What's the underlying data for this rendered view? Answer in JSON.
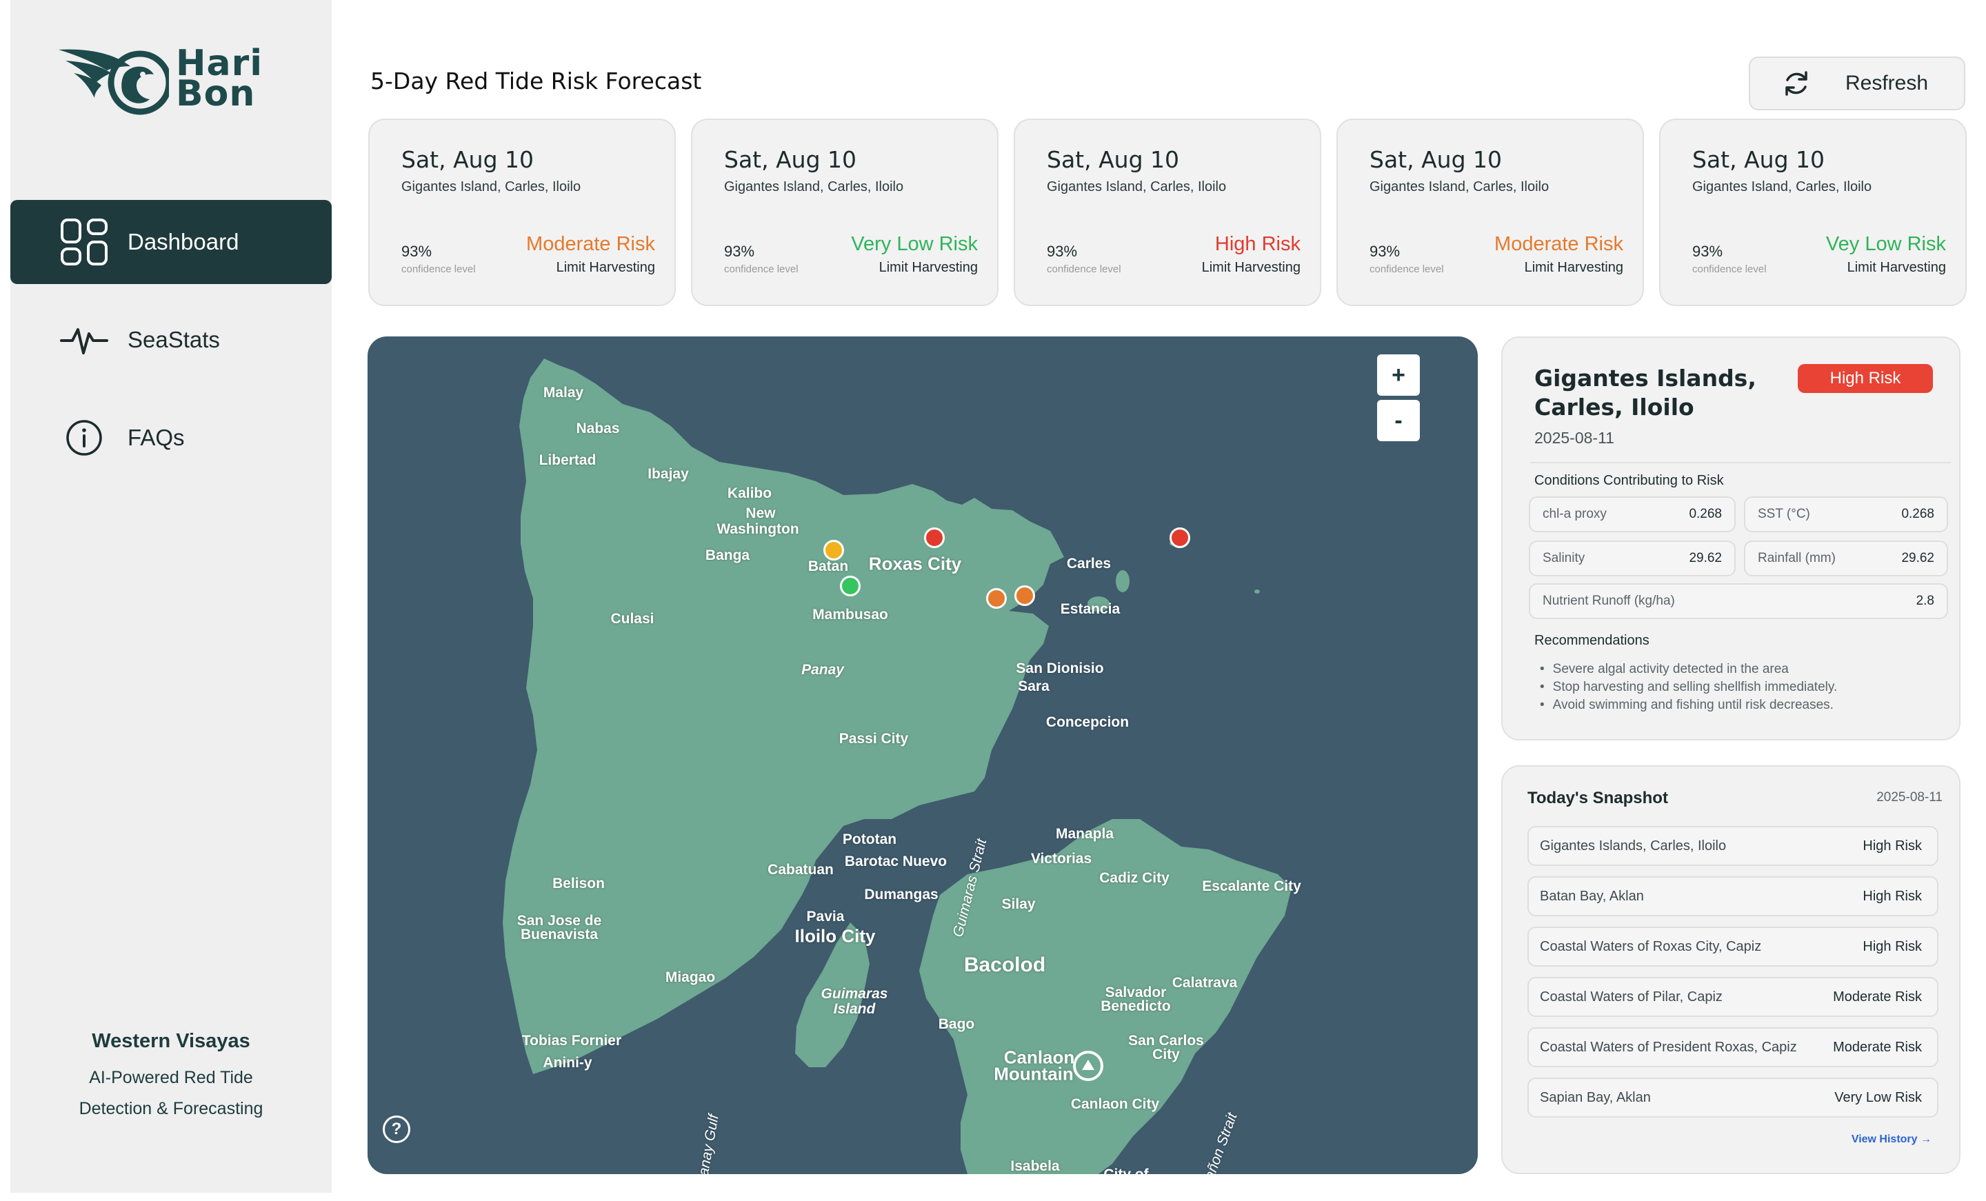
{
  "app": {
    "brand_line1": "Hari",
    "brand_line2": "Bon"
  },
  "nav": {
    "items": [
      {
        "label": "Dashboard",
        "icon": "grid-icon",
        "active": true
      },
      {
        "label": "SeaStats",
        "icon": "pulse-icon",
        "active": false
      },
      {
        "label": "FAQs",
        "icon": "info-icon",
        "active": false
      }
    ]
  },
  "footer": {
    "region": "Western Visayas",
    "tagline_line1": "AI-Powered Red Tide",
    "tagline_line2": "Detection & Forecasting"
  },
  "header": {
    "title": "5-Day Red Tide Risk Forecast",
    "refresh_label": "Resfresh"
  },
  "forecast": [
    {
      "date": "Sat, Aug 10",
      "location": "Gigantes Island, Carles, Iloilo",
      "confidence": "93%",
      "confidence_label": "confidence level",
      "risk": "Moderate Risk",
      "risk_color": "#e5792c",
      "action": "Limit Harvesting"
    },
    {
      "date": "Sat, Aug 10",
      "location": "Gigantes Island, Carles, Iloilo",
      "confidence": "93%",
      "confidence_label": "confidence level",
      "risk": "Very Low Risk",
      "risk_color": "#2fb35a",
      "action": "Limit Harvesting"
    },
    {
      "date": "Sat, Aug 10",
      "location": "Gigantes Island, Carles, Iloilo",
      "confidence": "93%",
      "confidence_label": "confidence level",
      "risk": "High Risk",
      "risk_color": "#e23b2e",
      "action": "Limit Harvesting"
    },
    {
      "date": "Sat, Aug 10",
      "location": "Gigantes Island, Carles, Iloilo",
      "confidence": "93%",
      "confidence_label": "confidence level",
      "risk": "Moderate Risk",
      "risk_color": "#e5792c",
      "action": "Limit Harvesting"
    },
    {
      "date": "Sat, Aug 10",
      "location": "Gigantes Island, Carles, Iloilo",
      "confidence": "93%",
      "confidence_label": "confidence level",
      "risk": "Vey Low Risk",
      "risk_color": "#2fb35a",
      "action": "Limit Harvesting"
    }
  ],
  "map": {
    "zoom_in": "+",
    "zoom_out": "-",
    "help": "?",
    "water_color": "#3f5b6c",
    "land_color": "#6fa893",
    "labels": [
      "Malay",
      "Nabas",
      "Libertad",
      "Ibajay",
      "Kalibo",
      "New",
      "Washington",
      "Banga",
      "Batan",
      "Roxas City",
      "Carles",
      "Mambusao",
      "Estancia",
      "Culasi",
      "Panay",
      "San Dionisio",
      "Sara",
      "Passi City",
      "Concepcion",
      "Manapla",
      "Pototan",
      "Victorias",
      "Barotac Nuevo",
      "Cabatuan",
      "Cadiz City",
      "Escalante City",
      "Dumangas",
      "Silay",
      "Belison",
      "San Jose de",
      "Buenavista",
      "Pavia",
      "Iloilo City",
      "Guimaras Strait",
      "Bacolod",
      "Calatrava",
      "Miagao",
      "Guimaras",
      "Island",
      "Salvador",
      "Benedicto",
      "Bago",
      "Tobias Fornier",
      "Anini-y",
      "San Carlos",
      "City",
      "Canlaon",
      "Mountain",
      "Canlaon City",
      "Panay Gulf",
      "Isabela",
      "City of",
      "Tañon Strait"
    ],
    "markers": [
      {
        "name": "marker-batan",
        "color": "#f2b21f"
      },
      {
        "name": "marker-mambusao",
        "color": "#36c45e"
      },
      {
        "name": "marker-roxas",
        "color": "#e23b2e"
      },
      {
        "name": "marker-pilar",
        "color": "#e5792c"
      },
      {
        "name": "marker-president-roxas",
        "color": "#e5792c"
      },
      {
        "name": "marker-gigantes",
        "color": "#e23b2e"
      }
    ]
  },
  "detail": {
    "title": "Gigantes Islands, Carles, Iloilo",
    "risk_badge": "High Risk",
    "risk_color": "#e84334",
    "date": "2025-08-11",
    "conditions_heading": "Conditions Contributing to Risk",
    "metrics": [
      {
        "label": "chl-a proxy",
        "value": "0.268"
      },
      {
        "label": "SST (°C)",
        "value": "0.268"
      },
      {
        "label": "Salinity",
        "value": "29.62"
      },
      {
        "label": "Rainfall (mm)",
        "value": "29.62"
      },
      {
        "label": "Nutrient Runoff (kg/ha)",
        "value": "2.8"
      }
    ],
    "recommendations_heading": "Recommendations",
    "recommendations": [
      "Severe algal activity detected in the area",
      "Stop harvesting and selling shellfish immediately.",
      "Avoid swimming and fishing until risk decreases."
    ]
  },
  "snapshot": {
    "title": "Today's Snapshot",
    "date": "2025-08-11",
    "rows": [
      {
        "location": "Gigantes Islands, Carles, Iloilo",
        "risk": "High Risk"
      },
      {
        "location": "Batan Bay, Aklan",
        "risk": "High Risk"
      },
      {
        "location": "Coastal Waters of Roxas City, Capiz",
        "risk": "High Risk"
      },
      {
        "location": "Coastal Waters of Pilar, Capiz",
        "risk": "Moderate Risk"
      },
      {
        "location": "Coastal Waters of President Roxas, Capiz",
        "risk": "Moderate Risk"
      },
      {
        "location": "Sapian Bay, Aklan",
        "risk": "Very Low Risk"
      }
    ],
    "history_link": "View History →"
  }
}
